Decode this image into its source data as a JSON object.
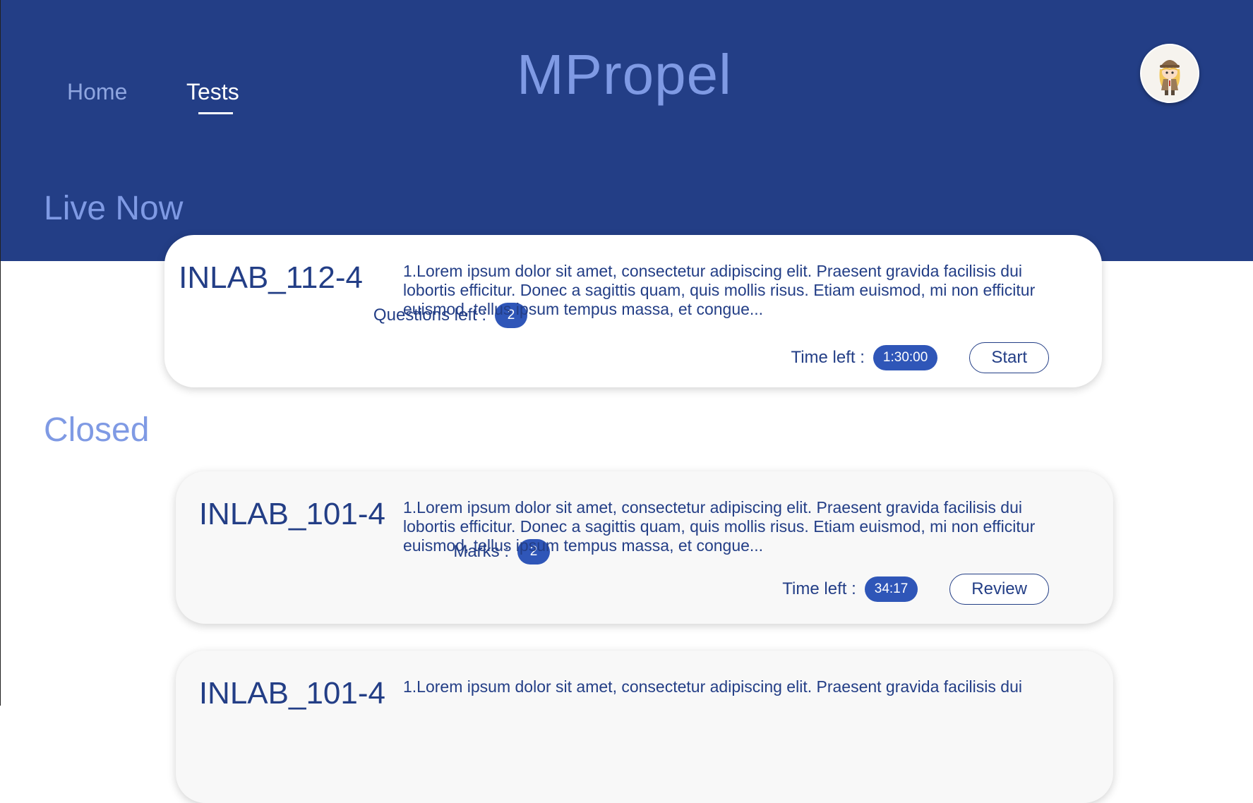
{
  "app": {
    "brand": "MPropel"
  },
  "nav": {
    "items": [
      {
        "label": "Home"
      },
      {
        "label": "Tests"
      }
    ]
  },
  "avatar": {
    "icon": "avatar-icon"
  },
  "sections": {
    "live": "Live Now",
    "closed": "Closed"
  },
  "live_tests": [
    {
      "id": "INLAB_112-4",
      "meta_label": "Questions left :",
      "meta_value": "2",
      "description": "1.Lorem ipsum dolor sit amet, consectetur adipiscing elit. Praesent gravida facilisis dui lobortis efficitur. Donec a sagittis quam, quis mollis risus. Etiam euismod, mi non efficitur euismod, tellus ipsum tempus massa, et congue...",
      "time_label": "Time left :",
      "time_value": "1:30:00",
      "action": "Start"
    }
  ],
  "closed_tests": [
    {
      "id": "INLAB_101-4",
      "meta_label": "Marks :",
      "meta_value": "2",
      "description": "1.Lorem ipsum dolor sit amet, consectetur adipiscing elit. Praesent gravida facilisis dui lobortis efficitur. Donec a sagittis quam, quis mollis risus. Etiam euismod, mi non efficitur euismod, tellus ipsum tempus massa, et congue...",
      "time_label": "Time left :",
      "time_value": "34:17",
      "action": "Review"
    },
    {
      "id": "INLAB_101-4",
      "description": "1.Lorem ipsum dolor sit amet, consectetur adipiscing elit. Praesent gravida facilisis dui"
    }
  ],
  "colors": {
    "header_bg": "#233e86",
    "brand": "#7f9ae4",
    "pill": "#2f56b8",
    "text": "#233e86"
  }
}
